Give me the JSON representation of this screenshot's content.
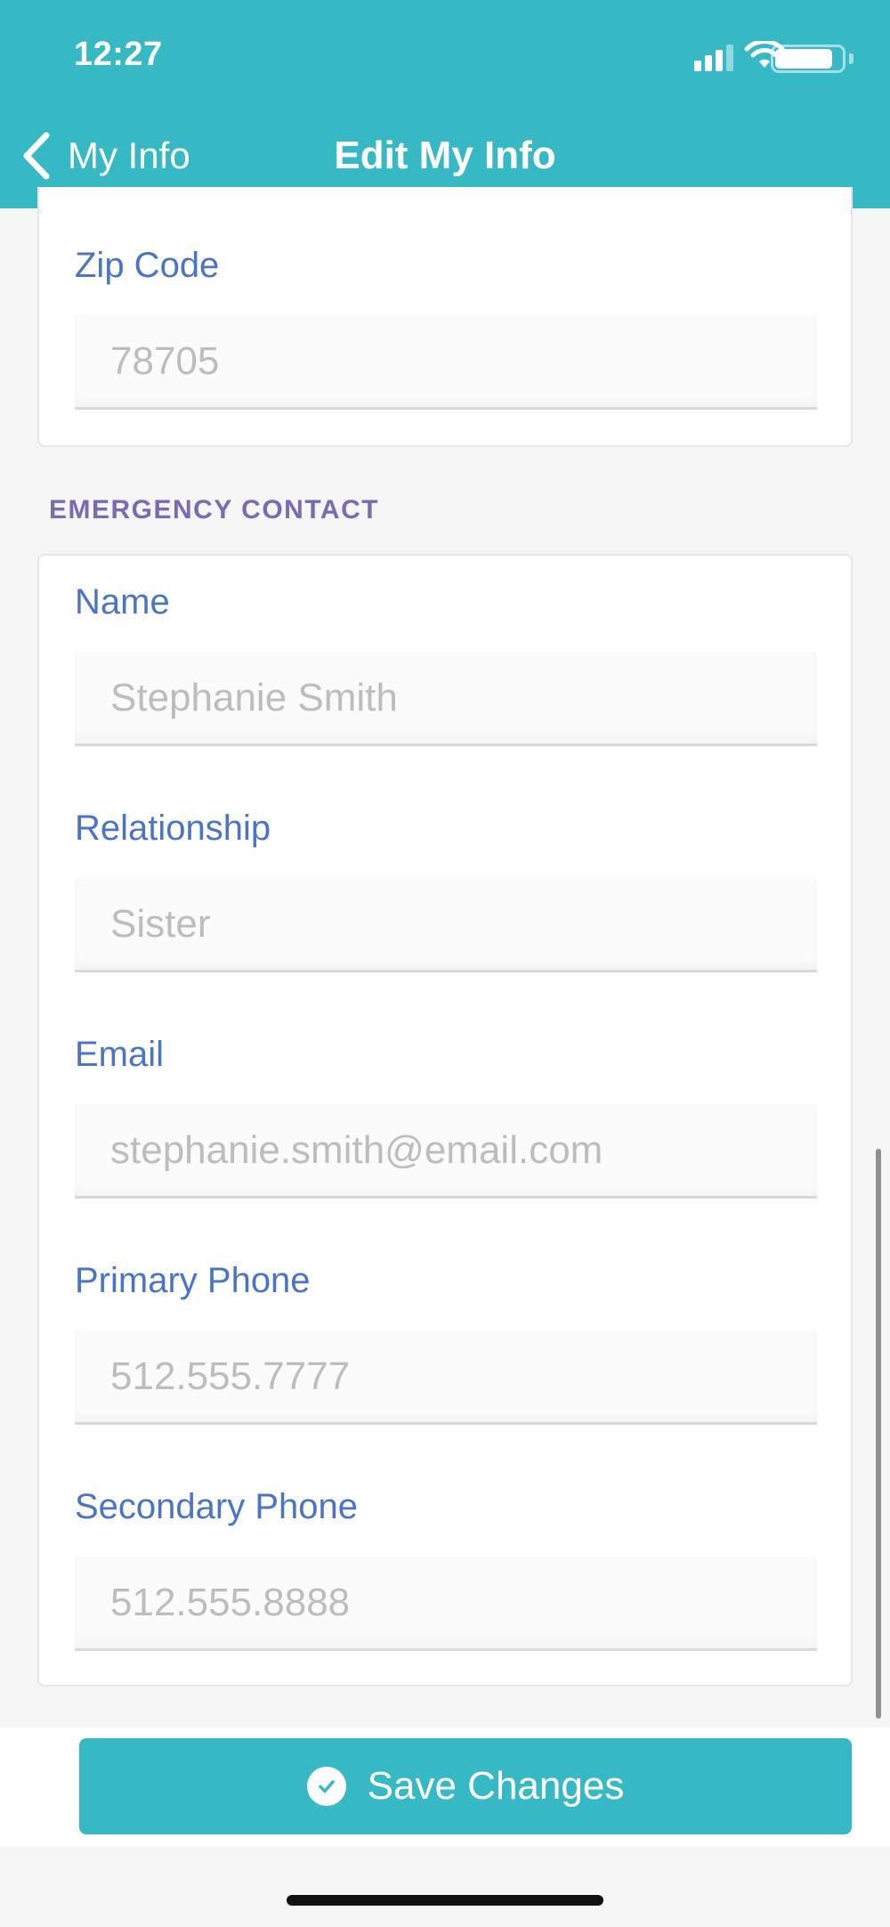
{
  "status_bar": {
    "time": "12:27",
    "icons": [
      "signal-icon",
      "wifi-icon",
      "battery-icon"
    ]
  },
  "nav": {
    "back_label": "My Info",
    "title": "Edit My Info"
  },
  "address": {
    "zip_label": "Zip Code",
    "zip_placeholder": "78705"
  },
  "emergency": {
    "section_title": "EMERGENCY CONTACT",
    "fields": [
      {
        "label": "Name",
        "placeholder": "Stephanie Smith"
      },
      {
        "label": "Relationship",
        "placeholder": "Sister"
      },
      {
        "label": "Email",
        "placeholder": "stephanie.smith@email.com"
      },
      {
        "label": "Primary Phone",
        "placeholder": "512.555.7777"
      },
      {
        "label": "Secondary Phone",
        "placeholder": "512.555.8888"
      }
    ]
  },
  "actions": {
    "save_label": "Save Changes",
    "save_icon": "check-circle-icon"
  },
  "colors": {
    "brand": "#36b9c4",
    "label": "#4a75c4",
    "section": "#7b6bb5",
    "placeholder": "#bdbdbd"
  }
}
